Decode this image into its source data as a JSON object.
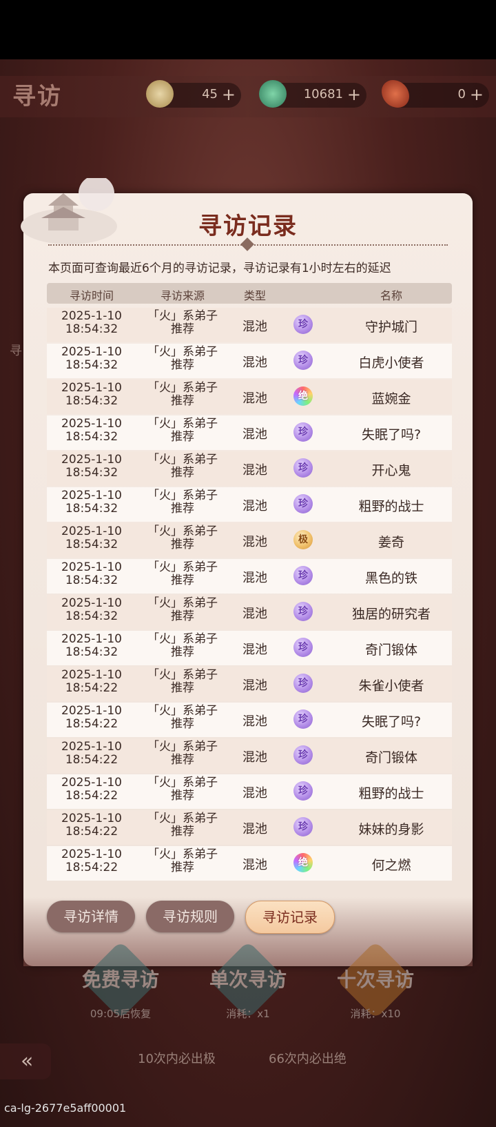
{
  "game": {
    "title": "寻访",
    "resources": [
      {
        "icon": "jade-coin-icon",
        "value": "45",
        "add": "+"
      },
      {
        "icon": "green-gem-icon",
        "value": "10681",
        "add": "+"
      },
      {
        "icon": "red-feather-icon",
        "value": "0",
        "add": "+"
      }
    ]
  },
  "modal": {
    "title": "寻访记录",
    "notice": "本页面可查询最近6个月的寻访记录，寻访记录有1小时左右的延迟",
    "columns": [
      "寻访时间",
      "寻访来源",
      "类型",
      "名称"
    ],
    "rows": [
      {
        "date": "2025-1-10",
        "time": "18:54:32",
        "src1": "「火」系弟子",
        "src2": "推荐",
        "type": "混池",
        "rarity": "珍",
        "rarity_class": "r-zhen",
        "name": "守护城门"
      },
      {
        "date": "2025-1-10",
        "time": "18:54:32",
        "src1": "「火」系弟子",
        "src2": "推荐",
        "type": "混池",
        "rarity": "珍",
        "rarity_class": "r-zhen",
        "name": "白虎小使者"
      },
      {
        "date": "2025-1-10",
        "time": "18:54:32",
        "src1": "「火」系弟子",
        "src2": "推荐",
        "type": "混池",
        "rarity": "绝",
        "rarity_class": "r-jue",
        "name": "蓝婉金"
      },
      {
        "date": "2025-1-10",
        "time": "18:54:32",
        "src1": "「火」系弟子",
        "src2": "推荐",
        "type": "混池",
        "rarity": "珍",
        "rarity_class": "r-zhen",
        "name": "失眠了吗?"
      },
      {
        "date": "2025-1-10",
        "time": "18:54:32",
        "src1": "「火」系弟子",
        "src2": "推荐",
        "type": "混池",
        "rarity": "珍",
        "rarity_class": "r-zhen",
        "name": "开心鬼"
      },
      {
        "date": "2025-1-10",
        "time": "18:54:32",
        "src1": "「火」系弟子",
        "src2": "推荐",
        "type": "混池",
        "rarity": "珍",
        "rarity_class": "r-zhen",
        "name": "粗野的战士"
      },
      {
        "date": "2025-1-10",
        "time": "18:54:32",
        "src1": "「火」系弟子",
        "src2": "推荐",
        "type": "混池",
        "rarity": "极",
        "rarity_class": "r-ji",
        "name": "姜奇"
      },
      {
        "date": "2025-1-10",
        "time": "18:54:32",
        "src1": "「火」系弟子",
        "src2": "推荐",
        "type": "混池",
        "rarity": "珍",
        "rarity_class": "r-zhen",
        "name": "黑色的铁"
      },
      {
        "date": "2025-1-10",
        "time": "18:54:32",
        "src1": "「火」系弟子",
        "src2": "推荐",
        "type": "混池",
        "rarity": "珍",
        "rarity_class": "r-zhen",
        "name": "独居的研究者"
      },
      {
        "date": "2025-1-10",
        "time": "18:54:32",
        "src1": "「火」系弟子",
        "src2": "推荐",
        "type": "混池",
        "rarity": "珍",
        "rarity_class": "r-zhen",
        "name": "奇门锻体"
      },
      {
        "date": "2025-1-10",
        "time": "18:54:22",
        "src1": "「火」系弟子",
        "src2": "推荐",
        "type": "混池",
        "rarity": "珍",
        "rarity_class": "r-zhen",
        "name": "朱雀小使者"
      },
      {
        "date": "2025-1-10",
        "time": "18:54:22",
        "src1": "「火」系弟子",
        "src2": "推荐",
        "type": "混池",
        "rarity": "珍",
        "rarity_class": "r-zhen",
        "name": "失眠了吗?"
      },
      {
        "date": "2025-1-10",
        "time": "18:54:22",
        "src1": "「火」系弟子",
        "src2": "推荐",
        "type": "混池",
        "rarity": "珍",
        "rarity_class": "r-zhen",
        "name": "奇门锻体"
      },
      {
        "date": "2025-1-10",
        "time": "18:54:22",
        "src1": "「火」系弟子",
        "src2": "推荐",
        "type": "混池",
        "rarity": "珍",
        "rarity_class": "r-zhen",
        "name": "粗野的战士"
      },
      {
        "date": "2025-1-10",
        "time": "18:54:22",
        "src1": "「火」系弟子",
        "src2": "推荐",
        "type": "混池",
        "rarity": "珍",
        "rarity_class": "r-zhen",
        "name": "妹妹的身影"
      },
      {
        "date": "2025-1-10",
        "time": "18:54:22",
        "src1": "「火」系弟子",
        "src2": "推荐",
        "type": "混池",
        "rarity": "绝",
        "rarity_class": "r-jue",
        "name": "何之燃"
      }
    ]
  },
  "tabs": [
    {
      "label": "寻访详情",
      "active": false
    },
    {
      "label": "寻访规则",
      "active": false
    },
    {
      "label": "寻访记录",
      "active": true
    }
  ],
  "actions": [
    {
      "label": "免费寻访",
      "sub": "09:05后恢复"
    },
    {
      "label": "单次寻访",
      "sub": "消耗：x1"
    },
    {
      "label": "十次寻访",
      "sub": "消耗：x10"
    }
  ],
  "guarantees": [
    "10次内必出极",
    "66次内必出绝"
  ],
  "side_hint_left": "寻",
  "footer_id": "ca-lg-2677e5aff00001",
  "colors": {
    "accent": "#7a2c1e",
    "modal_bg": "#f6ece5",
    "rarity_zhen": "#b48ee8",
    "rarity_ji": "#f0c06a"
  }
}
